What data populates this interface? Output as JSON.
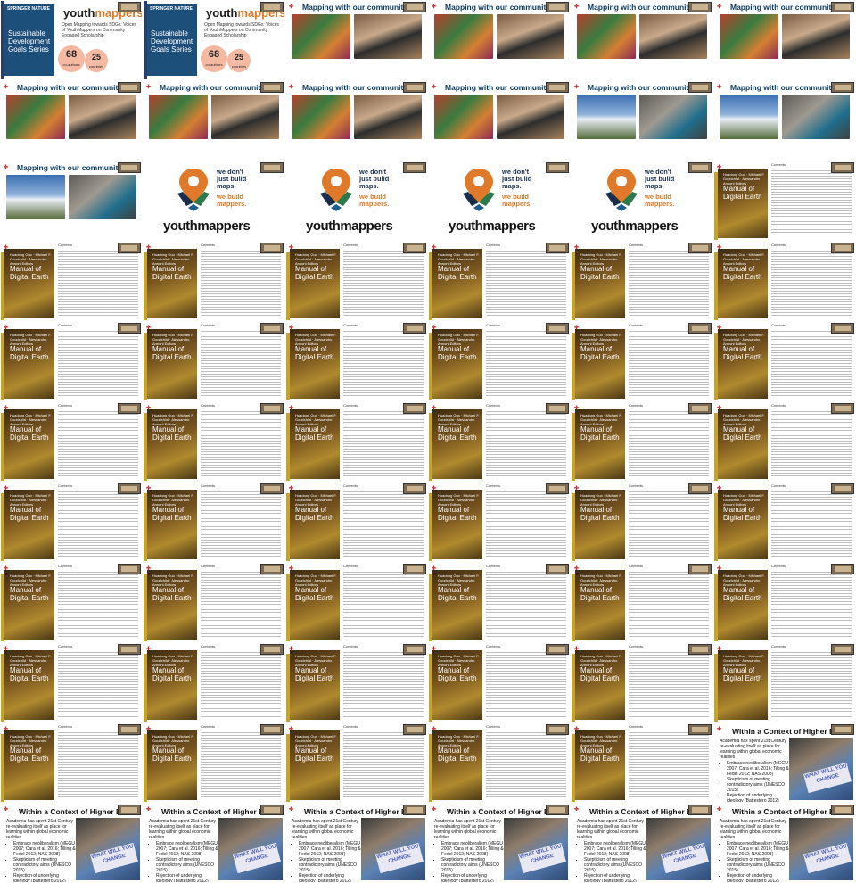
{
  "book": {
    "brand": "SPRINGER NATURE",
    "series": "Sustainable Development Goals Series",
    "title_brand_a": "youth",
    "title_brand_b": "mappers",
    "subtitle": "Open Mapping towards SDGs: Voices of YouthMappers on Community Engaged Scholarship",
    "coauthors_num": "68",
    "coauthors_label": "co-authors",
    "countries_num": "25",
    "countries_label": "countries"
  },
  "community": {
    "heading": "Mapping with our communities"
  },
  "logo": {
    "line1": "we don't",
    "line2": "just build",
    "line3": "maps.",
    "line4": "we build",
    "line5": "mappers.",
    "wordmark": "youthmappers"
  },
  "manual": {
    "title": "Manual of Digital Earth",
    "authors": "Huadong Guo · Michael F. Goodchild · Alessandro Annoni Editors",
    "toc_header": "Contents"
  },
  "higher_ed": {
    "heading": "Within a Context of Higher Edu",
    "intro": "Academia has spent 21st Century re-evaluating itself as place for learning within global economic realities",
    "bullets": [
      "Embrace neoliberalism (MEGU 2007; Cara et al. 2016; Tilling & Fedel 2012; NAS 2008)",
      "Skepticism of meeting contradictory aims (UNESCO 2015)",
      "Rejection of underlying ideology (Battestero 2012)"
    ],
    "sign": "WHAT WILL YOU CHANGE"
  },
  "tiles": [
    "book",
    "book",
    "community",
    "community",
    "community",
    "community",
    "community",
    "community",
    "community",
    "community",
    "community2",
    "community2",
    "community2",
    "logo",
    "logo",
    "logo",
    "logo",
    "manual",
    "manual",
    "manual",
    "manual",
    "manual",
    "manual",
    "manual",
    "manual",
    "manual",
    "manual",
    "manual",
    "manual",
    "manual",
    "manual",
    "manual",
    "manual",
    "manual",
    "manual",
    "manual",
    "manual",
    "manual",
    "manual",
    "manual",
    "manual",
    "manual",
    "manual",
    "manual",
    "manual",
    "manual",
    "manual",
    "manual",
    "manual",
    "manual",
    "manual",
    "manual",
    "manual",
    "manual",
    "manual",
    "manual",
    "manual",
    "manual",
    "manual",
    "highered",
    "highered",
    "highered",
    "highered",
    "highered",
    "highered",
    "highered"
  ]
}
